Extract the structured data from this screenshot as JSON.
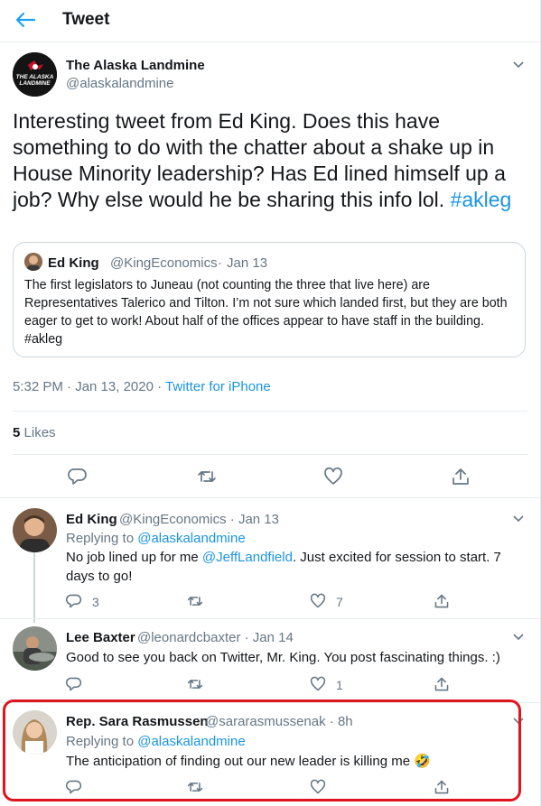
{
  "header": {
    "title": "Tweet"
  },
  "main_tweet": {
    "avatar_text": "THE ALASKA LANDMINE",
    "display_name": "The Alaska Landmine",
    "handle": "@alaskalandmine",
    "text": "Interesting tweet from Ed King. Does this have something to do with the chatter about a shake up in House Minority leadership? Has Ed lined himself up a job? Why else would he be sharing this info lol.",
    "hashtag": "#akleg",
    "quote": {
      "display_name": "Ed King",
      "handle": "@KingEconomics",
      "separator": "·",
      "date": "Jan 13",
      "text": "The first legislators to Juneau (not counting the three that live here) are Representatives Talerico and Tilton. I’m not sure which landed first, but they are both eager to get to work! About half of the offices appear to have staff in the building. #akleg"
    },
    "timestamp": "5:32 PM · Jan 13, 2020 ·",
    "source": "Twitter for iPhone",
    "likes_count": "5",
    "likes_label": "Likes"
  },
  "replies": [
    {
      "display_name": "Ed King",
      "handle": "@KingEconomics · Jan 13",
      "replying_label": "Replying to",
      "replying_to": "@alaskalandmine",
      "text_a": "No job lined up for me",
      "mention": "@JeffLandfield",
      "text_b": ". Just excited for session to start. 7",
      "text_c": "days to go!",
      "reply_count": "3",
      "retweet_count": "",
      "like_count": "7"
    },
    {
      "display_name": "Lee Baxter",
      "handle": "@leonardcbaxter · Jan 14",
      "text": "Good to see you back on Twitter, Mr. King.  You post fascinating things.  :)",
      "reply_count": "",
      "retweet_count": "",
      "like_count": "1"
    },
    {
      "display_name": "Rep. Sara Rasmussen",
      "handle": "@sararasmussenak · 8h",
      "replying_label": "Replying to",
      "replying_to": "@alaskalandmine",
      "text": "The anticipation of finding out our new leader is killing me",
      "emoji": "🤣"
    }
  ],
  "icons": {
    "back": "arrow-left-icon",
    "chevron": "chevron-down-icon",
    "reply": "reply-icon",
    "retweet": "retweet-icon",
    "like": "heart-icon",
    "share": "share-icon"
  },
  "colors": {
    "accent": "#1da1f2",
    "link": "#1b95e0",
    "secondary_text": "#657786",
    "highlight_border": "#e0141e"
  }
}
